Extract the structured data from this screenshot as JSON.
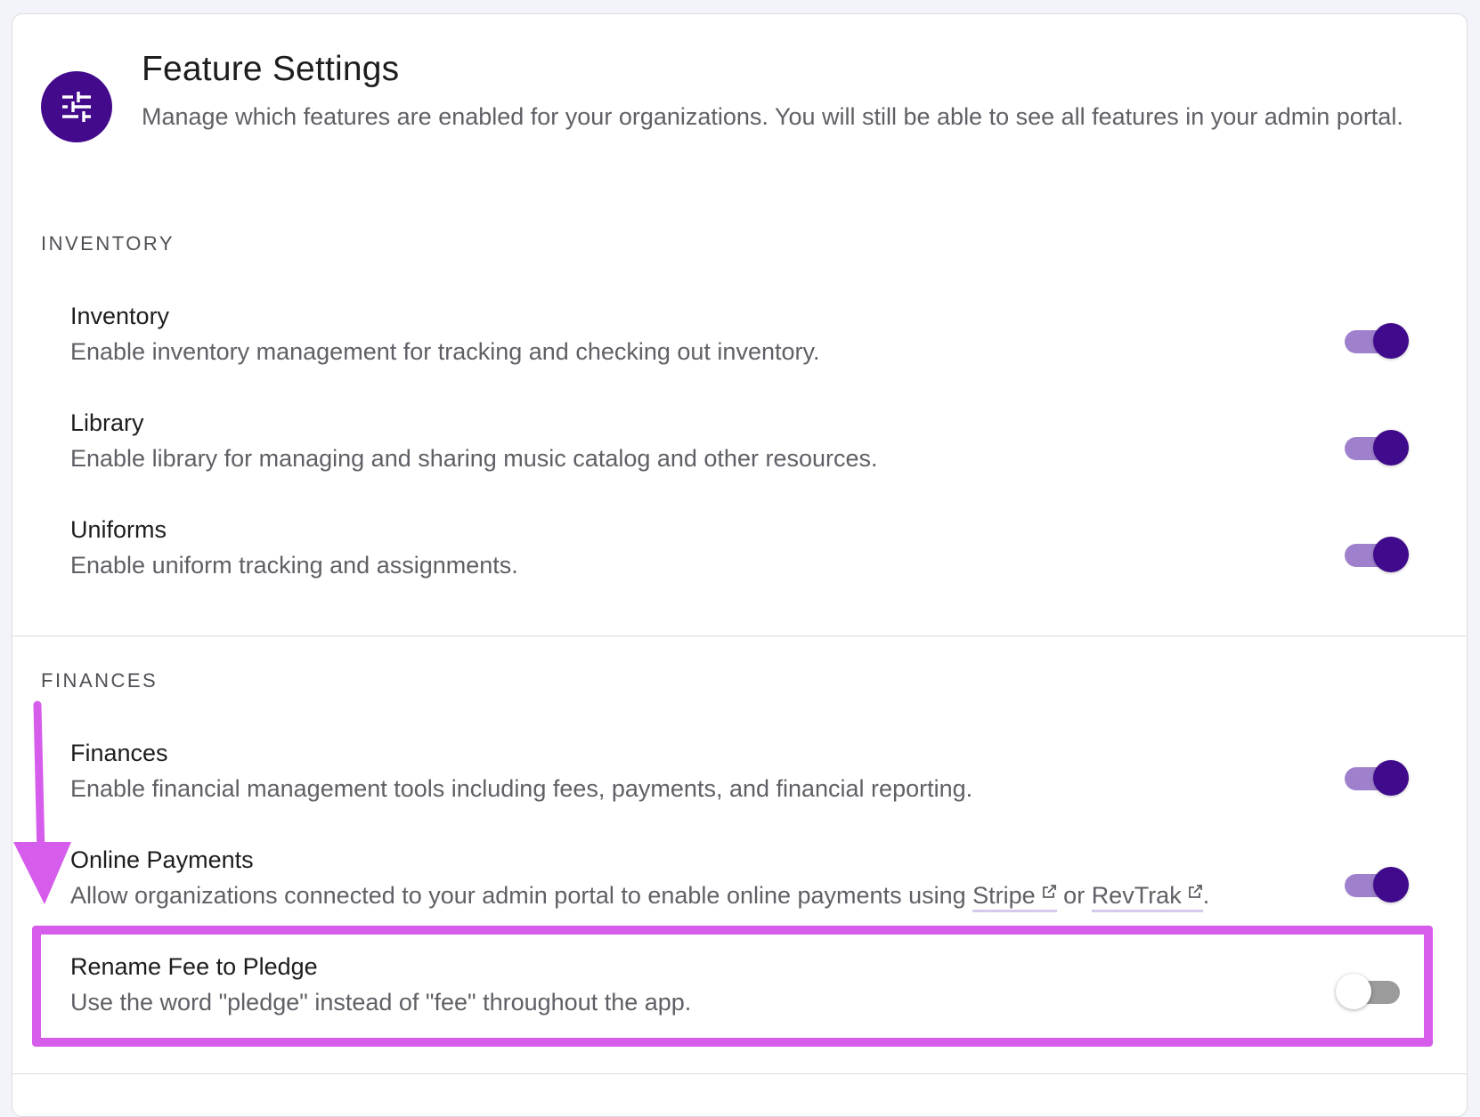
{
  "header": {
    "icon": "sliders-icon",
    "title": "Feature Settings",
    "description": "Manage which features are enabled for your organizations. You will still be able to see all features in your admin portal."
  },
  "sections": [
    {
      "label": "INVENTORY",
      "items": [
        {
          "title": "Inventory",
          "description": "Enable inventory management for tracking and checking out inventory.",
          "enabled": true
        },
        {
          "title": "Library",
          "description": "Enable library for managing and sharing music catalog and other resources.",
          "enabled": true
        },
        {
          "title": "Uniforms",
          "description": "Enable uniform tracking and assignments.",
          "enabled": true
        }
      ]
    },
    {
      "label": "FINANCES",
      "items": [
        {
          "title": "Finances",
          "description": "Enable financial management tools including fees, payments, and financial reporting.",
          "enabled": true
        },
        {
          "title": "Online Payments",
          "description_prefix": "Allow organizations connected to your admin portal to enable online payments using ",
          "link1": "Stripe",
          "connector": " or ",
          "link2": "RevTrak",
          "description_suffix": ".",
          "enabled": true
        },
        {
          "title": "Rename Fee to Pledge",
          "description": "Use the word \"pledge\" instead of \"fee\" throughout the app.",
          "enabled": false
        }
      ]
    }
  ],
  "colors": {
    "accent": "#430a8c",
    "toggle_track_on": "#9e80cc",
    "annotation": "#d65ceb"
  }
}
